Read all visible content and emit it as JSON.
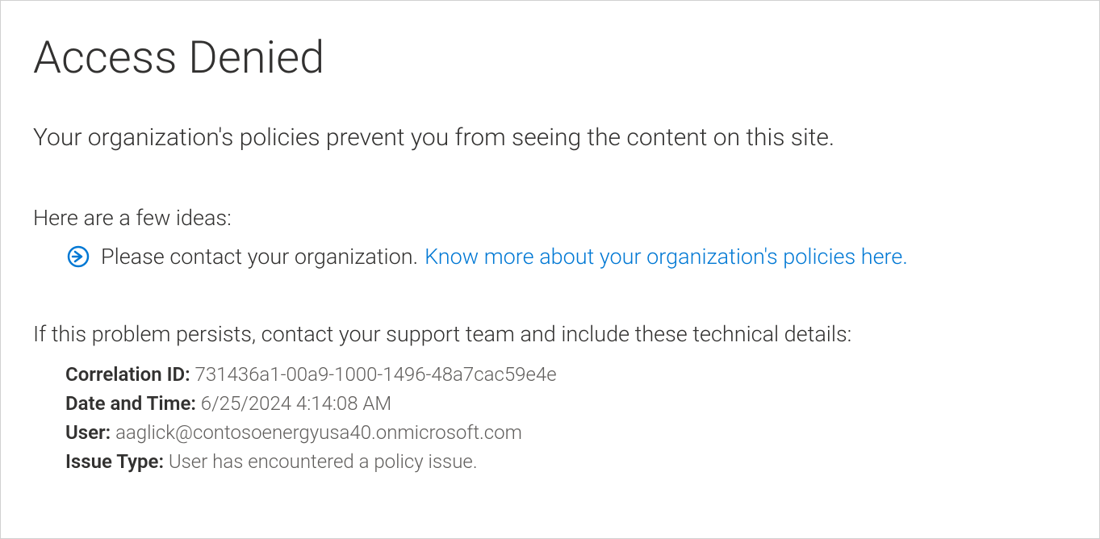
{
  "title": "Access Denied",
  "subtitle": "Your organization's policies prevent you from seeing the content on this site.",
  "ideasHeading": "Here are a few ideas:",
  "idea": {
    "text": "Please contact your organization.",
    "linkText": "Know more about your organization's policies here."
  },
  "supportText": "If this problem persists, contact your support team and include these technical details:",
  "details": {
    "correlationId": {
      "label": "Correlation ID:",
      "value": "731436a1-00a9-1000-1496-48a7cac59e4e"
    },
    "dateTime": {
      "label": "Date and Time:",
      "value": "6/25/2024 4:14:08 AM"
    },
    "user": {
      "label": "User:",
      "value": "aaglick@contosoenergyusa40.onmicrosoft.com"
    },
    "issueType": {
      "label": "Issue Type:",
      "value": "User has encountered a policy issue."
    }
  }
}
